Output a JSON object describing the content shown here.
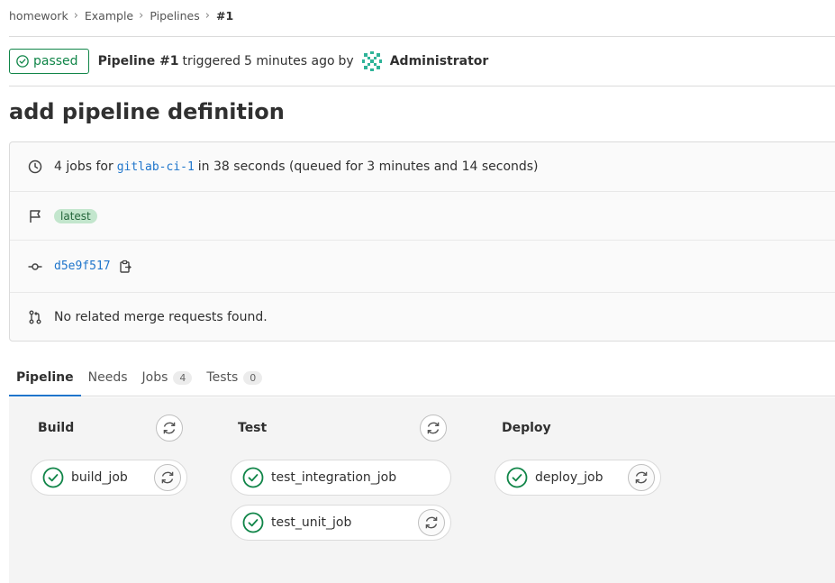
{
  "breadcrumb": [
    {
      "label": "homework"
    },
    {
      "label": "Example"
    },
    {
      "label": "Pipelines"
    },
    {
      "label": "#1"
    }
  ],
  "header": {
    "status": "passed",
    "pipeline_label": "Pipeline #1",
    "triggered": "triggered",
    "time_ago": "5 minutes ago",
    "by": "by",
    "user": "Administrator"
  },
  "title": "add pipeline definition",
  "info": {
    "jobs_prefix": "4 jobs for",
    "branch": "gitlab-ci-1",
    "duration": "in 38 seconds (queued for 3 minutes and 14 seconds)",
    "tag": "latest",
    "commit_sha": "d5e9f517",
    "merge_requests": "No related merge requests found."
  },
  "tabs": [
    {
      "label": "Pipeline"
    },
    {
      "label": "Needs"
    },
    {
      "label": "Jobs",
      "count": "4"
    },
    {
      "label": "Tests",
      "count": "0"
    }
  ],
  "stages": [
    {
      "name": "Build",
      "jobs": [
        "build_job"
      ]
    },
    {
      "name": "Test",
      "jobs": [
        "test_integration_job",
        "test_unit_job"
      ]
    },
    {
      "name": "Deploy",
      "jobs": [
        "deploy_job"
      ]
    }
  ],
  "colors": {
    "success": "#108548",
    "link": "#1f75cb",
    "tab_active": "#1f75cb"
  }
}
